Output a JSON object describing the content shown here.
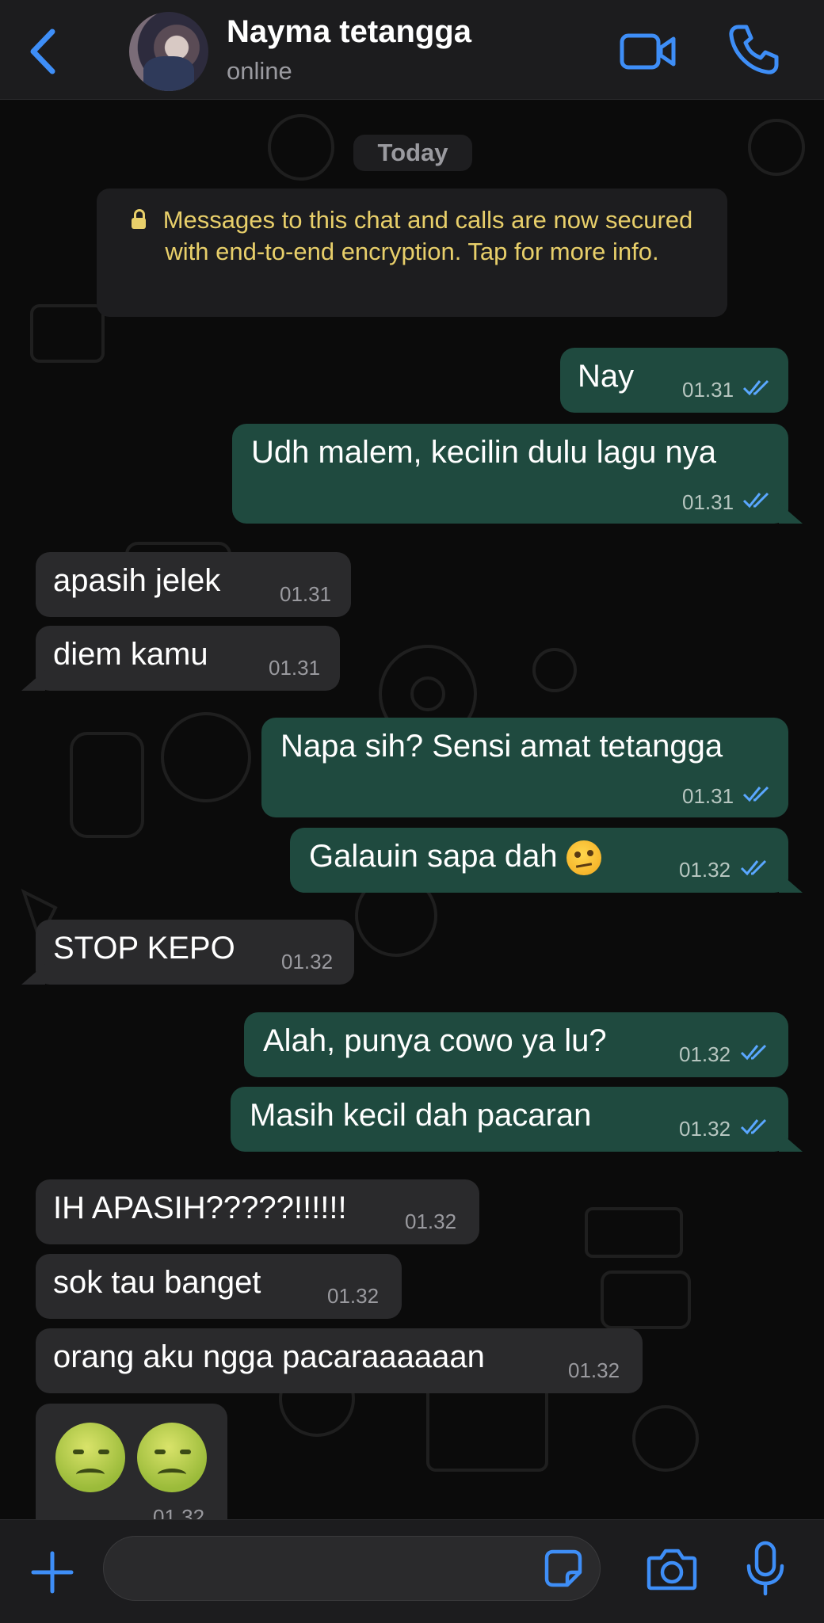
{
  "header": {
    "contact_name": "Nayma tetangga",
    "status": "online"
  },
  "chat": {
    "date_label": "Today",
    "encryption_notice": "Messages to this chat and calls are now secured with end-to-end encryption. Tap for more info.",
    "messages": [
      {
        "direction": "out",
        "text": "Nay",
        "time": "01.31",
        "read": true
      },
      {
        "direction": "out",
        "text": "Udh malem, kecilin dulu lagu nya",
        "time": "01.31",
        "read": true
      },
      {
        "direction": "in",
        "text": "apasih jelek",
        "time": "01.31"
      },
      {
        "direction": "in",
        "text": "diem kamu",
        "time": "01.31"
      },
      {
        "direction": "out",
        "text": "Napa sih? Sensi amat tetangga",
        "time": "01.31",
        "read": true
      },
      {
        "direction": "out",
        "text": "Galauin sapa dah",
        "emoji": "face-with-raised-eyebrow",
        "time": "01.32",
        "read": true
      },
      {
        "direction": "in",
        "text": "STOP KEPO",
        "time": "01.32"
      },
      {
        "direction": "out",
        "text": "Alah, punya cowo ya lu?",
        "time": "01.32",
        "read": true
      },
      {
        "direction": "out",
        "text": "Masih kecil dah pacaran",
        "time": "01.32",
        "read": true
      },
      {
        "direction": "in",
        "text": "IH APASIH?????!!!!!!",
        "time": "01.32"
      },
      {
        "direction": "in",
        "text": "sok tau banget",
        "time": "01.32"
      },
      {
        "direction": "in",
        "text": "orang aku ngga pacaraaaaaan",
        "time": "01.32"
      },
      {
        "direction": "in",
        "emoji": "nauseated-face x2",
        "time": "01.32"
      }
    ]
  },
  "input_bar": {
    "placeholder": ""
  },
  "colors": {
    "accent": "#3e8ef7",
    "outgoing_bubble": "#1f4a3f",
    "incoming_bubble": "#2a2a2c",
    "notice_text": "#e8cf6a"
  },
  "icons": [
    "back-chevron-icon",
    "video-call-icon",
    "phone-icon",
    "lock-icon",
    "double-check-icon",
    "plus-icon",
    "sticker-icon",
    "camera-icon",
    "microphone-icon"
  ]
}
